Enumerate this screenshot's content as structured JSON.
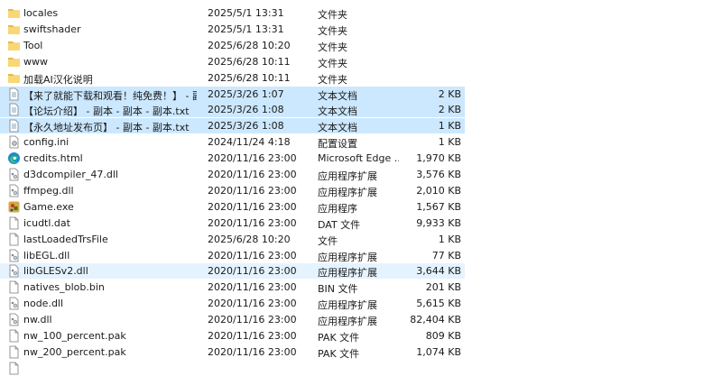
{
  "files": [
    {
      "name": "locales",
      "date": "2025/5/1 13:31",
      "type": "文件夹",
      "size": "",
      "icon": "folder-icon",
      "state": ""
    },
    {
      "name": "swiftshader",
      "date": "2025/5/1 13:31",
      "type": "文件夹",
      "size": "",
      "icon": "folder-icon",
      "state": ""
    },
    {
      "name": "Tool",
      "date": "2025/6/28 10:20",
      "type": "文件夹",
      "size": "",
      "icon": "folder-icon",
      "state": ""
    },
    {
      "name": "www",
      "date": "2025/6/28 10:11",
      "type": "文件夹",
      "size": "",
      "icon": "folder-icon",
      "state": ""
    },
    {
      "name": "加载AI汉化说明",
      "date": "2025/6/28 10:11",
      "type": "文件夹",
      "size": "",
      "icon": "folder-icon",
      "state": ""
    },
    {
      "name": "【来了就能下载和观看！纯免费！】 - 副...",
      "date": "2025/3/26 1:07",
      "type": "文本文档",
      "size": "2 KB",
      "icon": "text-file-icon",
      "state": "sel"
    },
    {
      "name": "【论坛介绍】 - 副本 - 副本 - 副本.txt",
      "date": "2025/3/26 1:08",
      "type": "文本文档",
      "size": "2 KB",
      "icon": "text-file-icon",
      "state": "sel"
    },
    {
      "name": "【永久地址发布页】 - 副本 - 副本.txt",
      "date": "2025/3/26 1:08",
      "type": "文本文档",
      "size": "1 KB",
      "icon": "text-file-icon",
      "state": "sel"
    },
    {
      "name": "config.ini",
      "date": "2024/11/24 4:18",
      "type": "配置设置",
      "size": "1 KB",
      "icon": "config-file-icon",
      "state": ""
    },
    {
      "name": "credits.html",
      "date": "2020/11/16 23:00",
      "type": "Microsoft Edge ...",
      "size": "1,970 KB",
      "icon": "edge-icon",
      "state": ""
    },
    {
      "name": "d3dcompiler_47.dll",
      "date": "2020/11/16 23:00",
      "type": "应用程序扩展",
      "size": "3,576 KB",
      "icon": "dll-file-icon",
      "state": ""
    },
    {
      "name": "ffmpeg.dll",
      "date": "2020/11/16 23:00",
      "type": "应用程序扩展",
      "size": "2,010 KB",
      "icon": "dll-file-icon",
      "state": ""
    },
    {
      "name": "Game.exe",
      "date": "2020/11/16 23:00",
      "type": "应用程序",
      "size": "1,567 KB",
      "icon": "game-exe-icon",
      "state": ""
    },
    {
      "name": "icudtl.dat",
      "date": "2020/11/16 23:00",
      "type": "DAT 文件",
      "size": "9,933 KB",
      "icon": "blank-file-icon",
      "state": ""
    },
    {
      "name": "lastLoadedTrsFile",
      "date": "2025/6/28 10:20",
      "type": "文件",
      "size": "1 KB",
      "icon": "blank-file-icon",
      "state": ""
    },
    {
      "name": "libEGL.dll",
      "date": "2020/11/16 23:00",
      "type": "应用程序扩展",
      "size": "77 KB",
      "icon": "dll-file-icon",
      "state": ""
    },
    {
      "name": "libGLESv2.dll",
      "date": "2020/11/16 23:00",
      "type": "应用程序扩展",
      "size": "3,644 KB",
      "icon": "dll-file-icon",
      "state": "hover"
    },
    {
      "name": "natives_blob.bin",
      "date": "2020/11/16 23:00",
      "type": "BIN 文件",
      "size": "201 KB",
      "icon": "blank-file-icon",
      "state": ""
    },
    {
      "name": "node.dll",
      "date": "2020/11/16 23:00",
      "type": "应用程序扩展",
      "size": "5,615 KB",
      "icon": "dll-file-icon",
      "state": ""
    },
    {
      "name": "nw.dll",
      "date": "2020/11/16 23:00",
      "type": "应用程序扩展",
      "size": "82,404 KB",
      "icon": "dll-file-icon",
      "state": ""
    },
    {
      "name": "nw_100_percent.pak",
      "date": "2020/11/16 23:00",
      "type": "PAK 文件",
      "size": "809 KB",
      "icon": "blank-file-icon",
      "state": ""
    },
    {
      "name": "nw_200_percent.pak",
      "date": "2020/11/16 23:00",
      "type": "PAK 文件",
      "size": "1,074 KB",
      "icon": "blank-file-icon",
      "state": ""
    },
    {
      "name": "",
      "date": "",
      "type": "",
      "size": "",
      "icon": "blank-file-icon",
      "state": ""
    }
  ],
  "colors": {
    "selected_bg": "#cce8ff",
    "hover_bg": "#e5f3ff",
    "folder": "#f8d775",
    "folder_dark": "#e8b84a"
  }
}
